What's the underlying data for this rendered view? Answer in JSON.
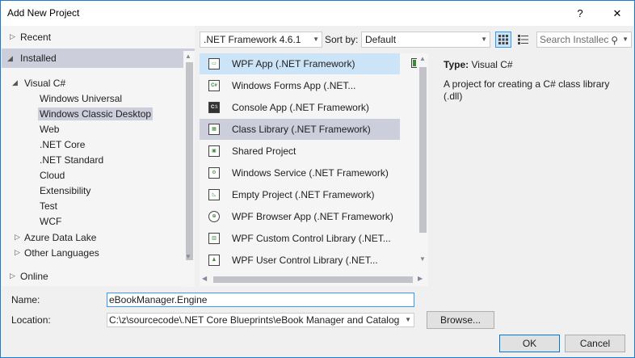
{
  "window": {
    "title": "Add New Project",
    "help_label": "?",
    "close_label": "✕"
  },
  "tree": {
    "recent": "Recent",
    "installed": "Installed",
    "visual_csharp": "Visual C#",
    "children": [
      "Windows Universal",
      "Windows Classic Desktop",
      "Web",
      ".NET Core",
      ".NET Standard",
      "Cloud",
      "Extensibility",
      "Test",
      "WCF"
    ],
    "selected_child": "Windows Classic Desktop",
    "azure_data_lake": "Azure Data Lake",
    "other_languages": "Other Languages",
    "online": "Online"
  },
  "toolbar": {
    "framework": ".NET Framework 4.6.1",
    "sort_label": "Sort by:",
    "sort_value": "Default",
    "search_placeholder": "Search Installec"
  },
  "templates": [
    {
      "name": "WPF App (.NET Framework)",
      "icon": "wpf-app-icon",
      "glyph": "▭"
    },
    {
      "name": "Windows Forms App (.NET...",
      "icon": "winforms-icon",
      "glyph": "C#"
    },
    {
      "name": "Console App (.NET Framework)",
      "icon": "console-icon",
      "glyph": "C:\\"
    },
    {
      "name": "Class Library (.NET Framework)",
      "icon": "class-library-icon",
      "glyph": "▦"
    },
    {
      "name": "Shared Project",
      "icon": "shared-project-icon",
      "glyph": "▣"
    },
    {
      "name": "Windows Service (.NET Framework)",
      "icon": "windows-service-icon",
      "glyph": "⚙"
    },
    {
      "name": "Empty Project (.NET Framework)",
      "icon": "empty-project-icon",
      "glyph": "◺"
    },
    {
      "name": "WPF Browser App (.NET Framework)",
      "icon": "wpf-browser-icon",
      "glyph": "⊕"
    },
    {
      "name": "WPF Custom Control Library (.NET...",
      "icon": "wpf-custom-control-icon",
      "glyph": "▥"
    },
    {
      "name": "WPF User Control Library (.NET...",
      "icon": "wpf-user-control-icon",
      "glyph": "♟"
    }
  ],
  "details": {
    "type_label": "Type:",
    "type_value": "Visual C#",
    "description": "A project for creating a C# class library (.dll)"
  },
  "form": {
    "name_label": "Name:",
    "name_value": "eBookManager.Engine",
    "location_label": "Location:",
    "location_value": "C:\\z\\sourcecode\\.NET Core Blueprints\\eBook Manager and Catalog",
    "browse_label": "Browse...",
    "ok_label": "OK",
    "cancel_label": "Cancel"
  },
  "colors": {
    "accent": "#1c7ad0",
    "selection": "#cce4f7",
    "hover": "#cccedb"
  }
}
